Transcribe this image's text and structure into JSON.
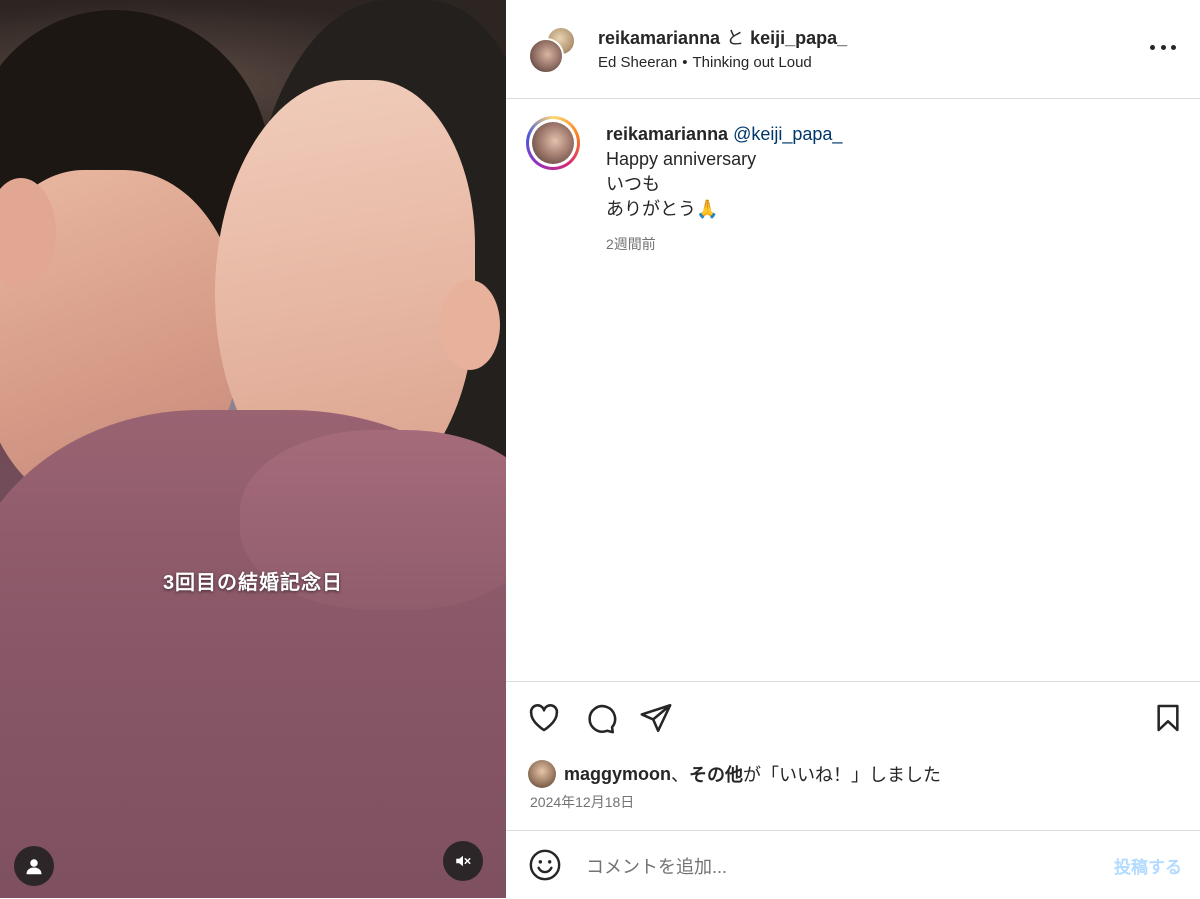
{
  "post": {
    "owner": "reikamarianna",
    "joiner": "と",
    "collaborator": "keiji_papa_",
    "music_artist": "Ed Sheeran",
    "music_separator": "•",
    "music_title": "Thinking out Loud"
  },
  "media": {
    "caption_overlay": "3回目の結婚記念日",
    "icons": {
      "user": "user-icon",
      "mute": "speaker-muted-icon"
    }
  },
  "comment": {
    "username": "reikamarianna",
    "mention": "@keiji_papa_",
    "line1": "Happy anniversary",
    "line2": "いつも",
    "line3": "ありがとう",
    "emoji": "🙏",
    "time": "2週間前"
  },
  "actions": {
    "icons": [
      "heart-icon",
      "comment-icon",
      "send-icon",
      "bookmark-icon"
    ]
  },
  "likes": {
    "first_liker": "maggymoon",
    "comma": "、",
    "others": "その他",
    "suffix": "が「いいね！」しました"
  },
  "date": "2024年12月18日",
  "composer": {
    "placeholder": "コメントを追加...",
    "post_label": "投稿する"
  },
  "colors": {
    "border": "#dbdbdb",
    "text": "#262626",
    "secondary": "#737373",
    "link": "#00376b",
    "post_disabled": "#b3dbff"
  }
}
